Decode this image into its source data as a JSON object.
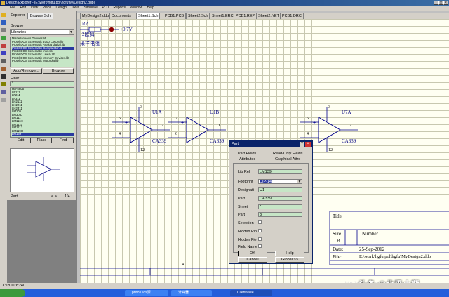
{
  "window": {
    "title": "Design Explorer - [E:\\work\\hgfu.pol\\hgfu\\MyDesign2.ddb]"
  },
  "menu": [
    "File",
    "Edit",
    "View",
    "Place",
    "Design",
    "Tools",
    "Simulate",
    "PLD",
    "Reports",
    "Window",
    "Help"
  ],
  "explorer": {
    "tabs": [
      "Explorer",
      "Browse Sch"
    ],
    "browse_label": "Browse",
    "browse_select": "Libraries",
    "libraries": [
      "Miscellaneous Devices.lib",
      "Protel DOS Schematic 4000 CMOS.lib",
      "Protel DOS Schematic Analog digital.lib",
      "Protel DOS Schematic Comparator.lib",
      "Protel DOS Schematic Intel.lib",
      "Protel DOS Schematic Linear.lib",
      "Protel DOS Schematic Memory Devices.lib",
      "Protel DOS Schematic Motorola.lib"
    ],
    "selected_library_index": 3,
    "add_remove_label": "Add/Remove...",
    "browse_button": "Browse",
    "filter_label": "Filter",
    "filter_value": "*",
    "components": [
      "HA-4905",
      "LF111",
      "LF211",
      "LF311",
      "LH2111",
      "LH2211",
      "LH2311",
      "LM106",
      "LM306J",
      "LM111",
      "LM111H",
      "LM111L",
      "LM111J",
      "LM119H",
      "LM139"
    ],
    "selected_component_index": 14,
    "edit_button": "Edit",
    "place_button": "Place",
    "find_button": "Find",
    "part_label": "Part",
    "part_nav": "< >",
    "part_counter": "1/4"
  },
  "doc_tabs": [
    "MyDesign2.ddb",
    "Documents",
    "Sheet1.Sch",
    "PCB1.PCB",
    "Sheet2.Sch",
    "Sheet1.ERC",
    "PCB1.REP",
    "Sheet2.NET",
    "PCB1.DRC"
  ],
  "active_doc_tab": 2,
  "schematic": {
    "resistor_ref": "R2",
    "resistor_value": "2欧姆",
    "resistor_note": "采样电阻",
    "power_label": "+0.7V",
    "opamps": [
      {
        "ref": "U1A",
        "part": "CA339",
        "pin_plus": "5",
        "pin_minus": "4",
        "pin_out": "2",
        "pin_top": "3",
        "pin_bottom": "12"
      },
      {
        "ref": "U1B",
        "part": "CA339",
        "pin_plus": "7",
        "pin_minus": "6",
        "pin_out": "1",
        "pin_top": "",
        "pin_bottom": ""
      },
      {
        "ref": "U7A",
        "part": "CA339",
        "pin_plus": "5",
        "pin_minus": "4",
        "pin_out": "2",
        "pin_top": "3",
        "pin_bottom": "12"
      }
    ],
    "title_block": {
      "title_label": "Title",
      "size_label": "Size",
      "size_value": "B",
      "number_label": "Number",
      "date_label": "Date:",
      "date_value": "25-Sep-2012",
      "file_label": "File:",
      "file_value": "E:\\work\\hgfu.pol\\hgfu\\MyDesign2.ddb"
    },
    "border_number": "4"
  },
  "dialog": {
    "title": "Part",
    "tabs_row1": [
      "Part Fields",
      "Read-Only Fields"
    ],
    "tabs_row2": [
      "Attributes",
      "Graphical Attrs"
    ],
    "fields": [
      {
        "label": "Lib Ref",
        "value": "LM139"
      },
      {
        "label": "Footprint",
        "value": "DIP-14"
      },
      {
        "label": "Designati",
        "value": "U1"
      },
      {
        "label": "Part",
        "value": "CA339"
      },
      {
        "label": "Sheet",
        "value": "*"
      },
      {
        "label": "Part",
        "value": "3"
      }
    ],
    "checks": [
      "Selection",
      "Hidden Pin",
      "Hidden Fiel",
      "Field Name"
    ],
    "buttons": [
      "OK",
      "Help",
      "Cancel",
      "Global >>"
    ]
  },
  "statusbar": {
    "coords": "X:1810 Y:240"
  },
  "taskbar": {
    "items": [
      "prinSDlos源...",
      "计算器",
      "Client99se"
    ]
  },
  "watermark": "http://blog.csdn.ne",
  "brand": "头条 @北极小熊",
  "colors": {
    "title_bar": "#0a246a",
    "sheet_bg": "#fffff2",
    "grid": "#c8c8b0",
    "wire": "#00008b",
    "part_text": "#000080",
    "selection": "#2a3aa0",
    "list_bg": "#c6e6c6"
  }
}
